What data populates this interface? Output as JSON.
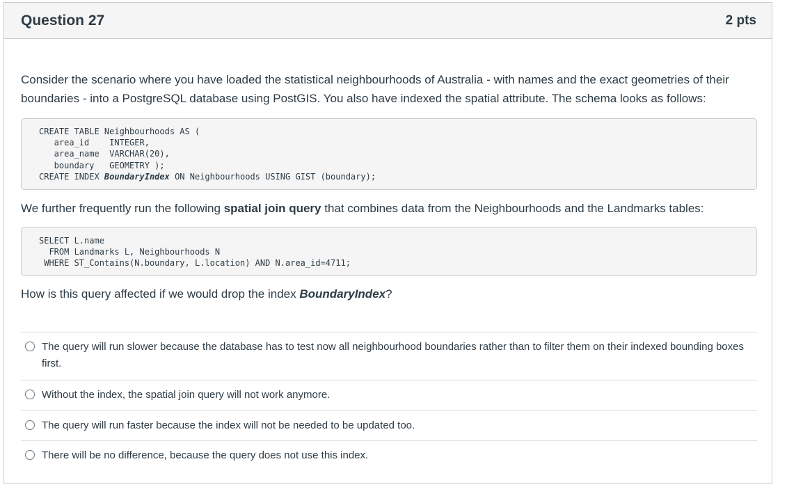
{
  "question": {
    "title": "Question 27",
    "points": "2 pts"
  },
  "intro": "Consider the scenario where you have loaded the statistical neighbourhoods of Australia - with names and the exact geometries of their boundaries - into a PostgreSQL database using PostGIS. You also have indexed the spatial attribute. The schema looks as follows:",
  "schema_code": {
    "line1": "CREATE TABLE Neighbourhoods AS (",
    "line2": "   area_id    INTEGER,",
    "line3": "   area_name  VARCHAR(20),",
    "line4": "   boundary   GEOMETRY );",
    "line5_prefix": "CREATE INDEX ",
    "line5_index": "BoundaryIndex",
    "line5_suffix": " ON Neighbourhoods USING GIST (boundary);"
  },
  "further": {
    "before": "We further frequently run the following ",
    "bold": "spatial join query",
    "after": " that combines data from the Neighbourhoods and the Landmarks tables:"
  },
  "query_code": {
    "line1": "SELECT L.name",
    "line2": "  FROM Landmarks L, Neighbourhoods N",
    "line3": " WHERE ST_Contains(N.boundary, L.location) AND N.area_id=4711;"
  },
  "prompt": {
    "before": "How is this query affected if we would drop the index ",
    "index": "BoundaryIndex",
    "after": "?"
  },
  "answers": [
    "The query will run slower because the database has to test now all neighbourhood boundaries rather than to filter them on their indexed bounding boxes first.",
    "Without the index, the spatial join query will not work anymore.",
    "The query will run faster because the index will not be needed to be updated too.",
    "There will be no difference, because the query does not use this index."
  ]
}
